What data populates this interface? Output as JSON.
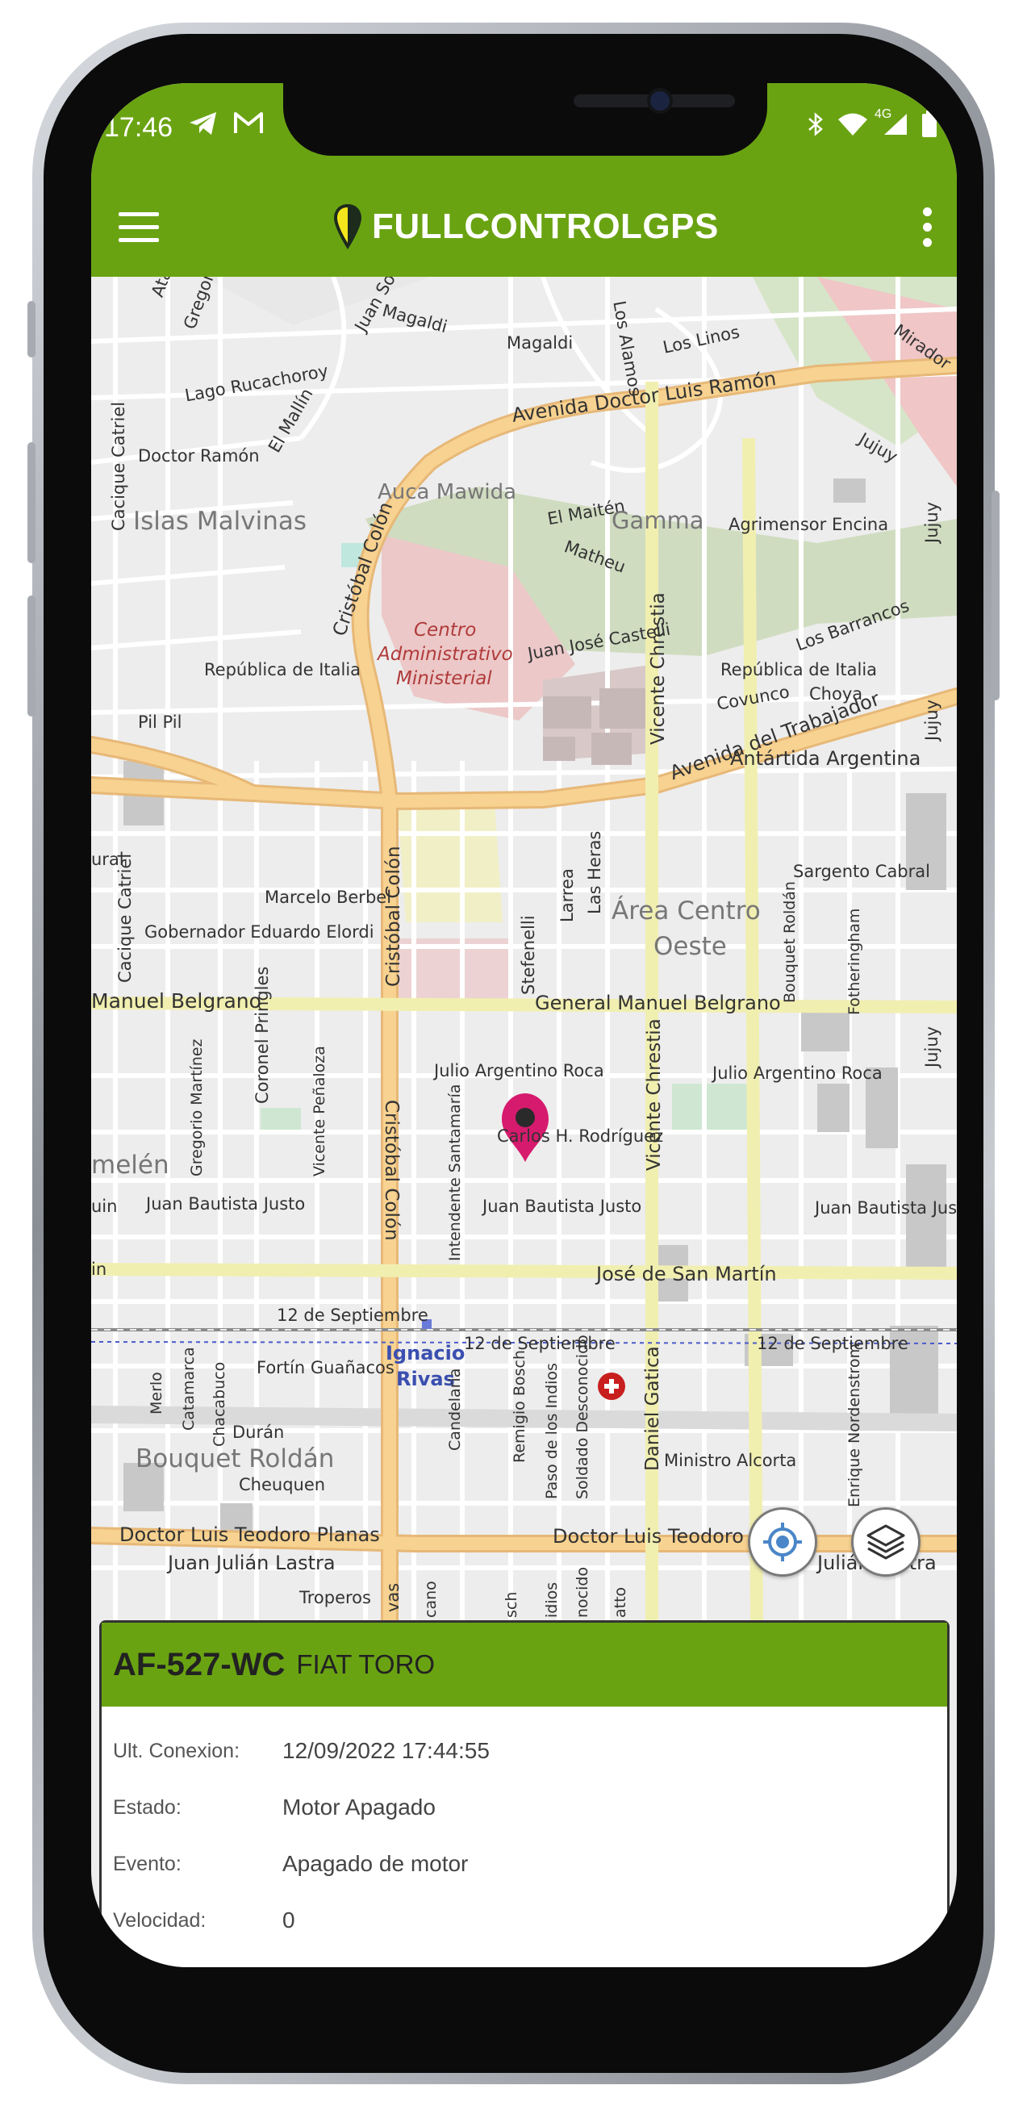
{
  "status_bar": {
    "time": "17:46",
    "network": "4G"
  },
  "app_bar": {
    "brand": "FULLCONTROLGPS"
  },
  "map": {
    "labels": {
      "atahualpa": "Atahualpa",
      "gregorio": "Gregorio",
      "juan_sou": "Juan Sou",
      "magaldi1": "Magaldi",
      "magaldi2": "Magaldi",
      "los_alamos": "Los Alamos",
      "los_linos": "Los Linos",
      "mirador": "Mirador",
      "lago_rucachoroy": "Lago Rucachoroy",
      "cacique_catriel_top": "Cacique Catriel",
      "doctor_ramon": "Doctor Ramón",
      "el_mallin": "El Mallín",
      "avenida_doctor_luis_ramon": "Avenida Doctor Luis Ramón",
      "jujuy_top": "Jujuy",
      "islas_malvinas": "Islas Malvinas",
      "auca_mawida": "Auca Mawida",
      "el_maiten": "El Maitén",
      "gamma": "Gamma",
      "agrimensor_encina": "Agrimensor Encina",
      "jujuy_right1": "Jujuy",
      "cristobal_colon_top": "Cristóbal Colón",
      "matheu": "Matheu",
      "centro_administrativo": "Centro",
      "centro_administrativo2": "Administrativo",
      "ministerial": "Ministerial",
      "juan_jose_castelli": "Juan José Castelli",
      "vicente_chrestia_top": "Vicente Chrestia",
      "los_barrancos": "Los Barrancos",
      "republica_italia_left": "República de Italia",
      "republica_italia_right": "República de Italia",
      "covunco": "Covunco",
      "choya": "Choya",
      "pil_pil": "Pil Pil",
      "avenida_del_trabajador": "Avenida del Trabajador",
      "jujuy_right2": "Jujuy",
      "antartida_argentina": "Antártida Argentina",
      "ural": "ural",
      "las_heras": "Las Heras",
      "sargento_cabral": "Sargento Cabral",
      "marcelo_berbel": "Marcelo Berbel",
      "larrea": "Larrea",
      "area_centro": "Área Centro",
      "oeste": "Oeste",
      "cacique_catriel_mid": "Cacique Catriel",
      "gobernador_elordi": "Gobernador Eduardo Elordi",
      "cristobal_colon_mid": "Cristóbal Colón",
      "bouquet_roldan_street": "Bouquet Roldán",
      "fotheringham": "Fotheringham",
      "manuel_belgrano_left": "Manuel Belgrano",
      "coronel_pringles": "Coronel Pringles",
      "stefenelli": "Stefenelli",
      "general_manuel_belgrano": "General Manuel Belgrano",
      "jujuy_right3": "Jujuy",
      "gregorio_martinez": "Gregorio Martínez",
      "vicente_penaloza": "Vicente Peñaloza",
      "julio_argentino_roca_left": "Julio Argentino Roca",
      "julio_argentino_roca_right": "Julio Argentino Roca",
      "intendente_santamaria": "Intendente Santamaría",
      "carlos_h_rodriguez": "Carlos H. Rodríguez",
      "vicente_chrestia_mid": "Vicente Chrestia",
      "cristobal_colon_low": "Cristóbal Colón",
      "melen": "melén",
      "juan_bautista_justo_left": "Juan Bautista Justo",
      "juin": "uin",
      "juan_bautista_justo_mid": "Juan Bautista Justo",
      "juan_bautista_justo_right": "Juan Bautista Justo",
      "in_left": "in",
      "jose_de_san_martin": "José de San Martín",
      "doce_septiembre_1": "12 de Septiembre",
      "doce_septiembre_2": "12 de Septiembre",
      "doce_septiembre_3": "12 de Septiembre",
      "ignacio_rivas1": "Ignacio",
      "ignacio_rivas2": "Rivas",
      "merlo": "Merlo",
      "catamarca": "Catamarca",
      "chacabuco": "Chacabuco",
      "fortin_guanacos": "Fortín Guañacos",
      "candelaria": "Candelaria",
      "remigio_bosch": "Remigio Bosch",
      "paso_de_los_indios": "Paso de los Indios",
      "soldado_desconocido": "Soldado Desconocido",
      "daniel_gatica": "Daniel Gatica",
      "enrique_nordenstrom": "Enrique Nordenstrom",
      "duran": "Durán",
      "bouquet_roldan": "Bouquet Roldán",
      "ministro_alcorta": "Ministro Alcorta",
      "cheuquen": "Cheuquen",
      "doctor_luis_teodoro_planas": "Doctor Luis Teodoro Planas",
      "doctor_luis_teodoro": "Doctor Luis Teodoro",
      "juan_julian_lastra": "Juan Julián Lastra",
      "julian_lastra_right": "Julián Lastra",
      "troperos": "Troperos",
      "vas": "vas",
      "cano": "cano",
      "sch": "sch",
      "idios": "idios",
      "nocido": "nocido",
      "atto": "atto"
    }
  },
  "info_panel": {
    "plate": "AF-527-WC",
    "model": "FIAT TORO",
    "rows": [
      {
        "label": "Ult. Conexion:",
        "value": "12/09/2022 17:44:55"
      },
      {
        "label": "Estado:",
        "value": "Motor Apagado"
      },
      {
        "label": "Evento:",
        "value": "Apagado de motor"
      },
      {
        "label": "Velocidad:",
        "value": "0"
      }
    ]
  }
}
